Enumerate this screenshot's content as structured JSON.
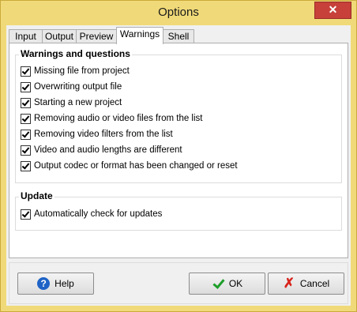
{
  "window": {
    "title": "Options",
    "close_icon": "close-icon",
    "close_glyph": "✕"
  },
  "tabs": [
    {
      "label": "Input",
      "active": false
    },
    {
      "label": "Output",
      "active": false
    },
    {
      "label": "Preview",
      "active": false
    },
    {
      "label": "Warnings",
      "active": true
    },
    {
      "label": "Shell",
      "active": false
    }
  ],
  "warnings_group": {
    "title": "Warnings and questions",
    "items": [
      {
        "label": "Missing file from project",
        "checked": true
      },
      {
        "label": "Overwriting output file",
        "checked": true
      },
      {
        "label": "Starting a new project",
        "checked": true
      },
      {
        "label": "Removing audio or video files from the list",
        "checked": true
      },
      {
        "label": "Removing video filters from the list",
        "checked": true
      },
      {
        "label": "Video and audio lengths are different",
        "checked": true
      },
      {
        "label": "Output codec or format has been changed or reset",
        "checked": true
      }
    ]
  },
  "update_group": {
    "title": "Update",
    "items": [
      {
        "label": "Automatically check for updates",
        "checked": true
      }
    ]
  },
  "buttons": {
    "help": {
      "label": "Help",
      "icon": "help-icon",
      "glyph": "?"
    },
    "ok": {
      "label": "OK",
      "icon": "checkmark-icon"
    },
    "cancel": {
      "label": "Cancel",
      "icon": "cancel-x-icon",
      "glyph": "✗"
    }
  },
  "colors": {
    "frame": "#f0d978",
    "close_button": "#c7403a"
  }
}
